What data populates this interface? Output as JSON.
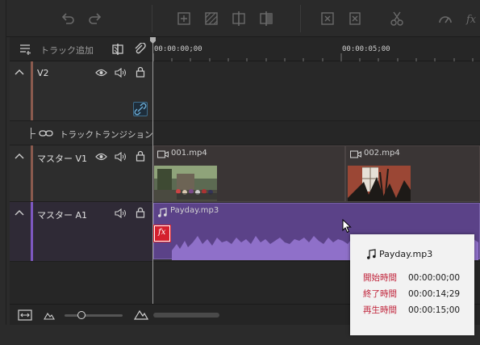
{
  "toolbar": {
    "icons": [
      "undo-icon",
      "redo-icon",
      "add-marker-icon",
      "transparency-icon",
      "split-icon",
      "crop-icon",
      "freeze-frame-icon",
      "delete-icon",
      "cut-icon",
      "speed-icon",
      "fx-icon"
    ]
  },
  "sidebar": {
    "add_track_label": "トラック追加"
  },
  "ruler": {
    "start_time": "00:00:00;00",
    "mid_time": "00:00:05;00"
  },
  "tracks": [
    {
      "name": "V2",
      "type": "video"
    },
    {
      "name": "トラックトランジション",
      "type": "transition"
    },
    {
      "name": "マスター V1",
      "type": "video"
    },
    {
      "name": "マスター A1",
      "type": "audio"
    }
  ],
  "clips": {
    "video1": "001.mp4",
    "video2": "002.mp4",
    "audio": "Payday.mp3",
    "fx_badge": "fx"
  },
  "tooltip": {
    "title": "Payday.mp3",
    "start_label": "開始時間",
    "start_value": "00:00:00;00",
    "end_label": "終了時間",
    "end_value": "00:00:14;29",
    "duration_label": "再生時間",
    "duration_value": "00:00:15;00"
  },
  "zoom": {
    "level": 0.08
  },
  "colors": {
    "video_stripe": "#8a5a4e",
    "audio_stripe": "#7d58c0",
    "audio_clip": "#5b4288",
    "waveform": "#8f70c9",
    "fx_red": "#d4202e",
    "tooltip_label": "#c0233a"
  }
}
